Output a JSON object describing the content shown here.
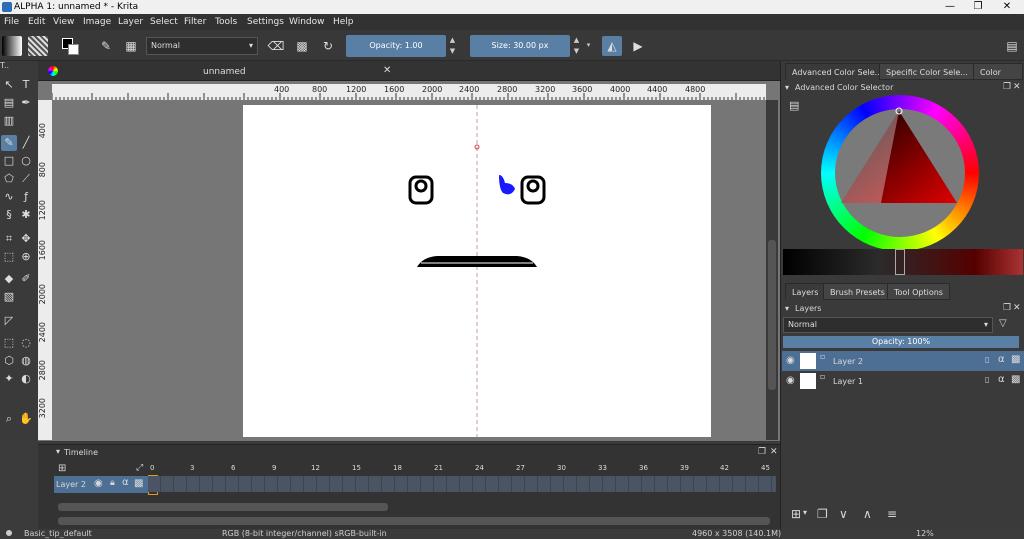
{
  "window": {
    "title": "ALPHA 1: unnamed * - Krita",
    "controls": [
      "—",
      "❐",
      "✕"
    ]
  },
  "menu": [
    "File",
    "Edit",
    "View",
    "Image",
    "Layer",
    "Select",
    "Filter",
    "Tools",
    "Settings",
    "Window",
    "Help"
  ],
  "toolbar": {
    "blend_mode": "Normal",
    "opacity_label": "Opacity:  1.00",
    "size_label": "Size:  30.00 px"
  },
  "document": {
    "tab_title": "unnamed"
  },
  "ruler": {
    "h_ticks": [
      "400",
      "800",
      "1200",
      "1600",
      "2000",
      "2400",
      "2800",
      "3200",
      "3600",
      "4000",
      "4400",
      "4800"
    ],
    "v_ticks": [
      "400",
      "800",
      "1200",
      "1600",
      "2000",
      "2400",
      "2800",
      "3200"
    ]
  },
  "timeline": {
    "title": "Timeline",
    "layer_name": "Layer 2",
    "frame_numbers": [
      "0",
      "3",
      "6",
      "9",
      "12",
      "15",
      "18",
      "21",
      "24",
      "27",
      "30",
      "33",
      "36",
      "39",
      "42",
      "45"
    ]
  },
  "right_panel": {
    "color_tabs": [
      "Advanced Color Sele...",
      "Specific Color Sele...",
      "Color Sli..."
    ],
    "color_docker_title": "Advanced Color Selector",
    "layer_tabs": [
      "Layers",
      "Brush Presets",
      "Tool Options"
    ],
    "layers_docker_title": "Layers",
    "blend_mode": "Normal",
    "opacity_label": "Opacity:  100%",
    "layers": [
      {
        "name": "Layer 2",
        "selected": true
      },
      {
        "name": "Layer 1",
        "selected": false
      }
    ]
  },
  "status": {
    "brush": "Basic_tip_default",
    "color_space": "RGB (8-bit integer/channel)  sRGB-built-in",
    "dimensions": "4960 x 3508 (140.1M)",
    "zoom": "12%"
  },
  "colors": {
    "accent": "#5a7fa5",
    "selected_row": "#4d6f94",
    "canvas_bg": "#767676",
    "panel_bg": "#3a3a3a"
  }
}
